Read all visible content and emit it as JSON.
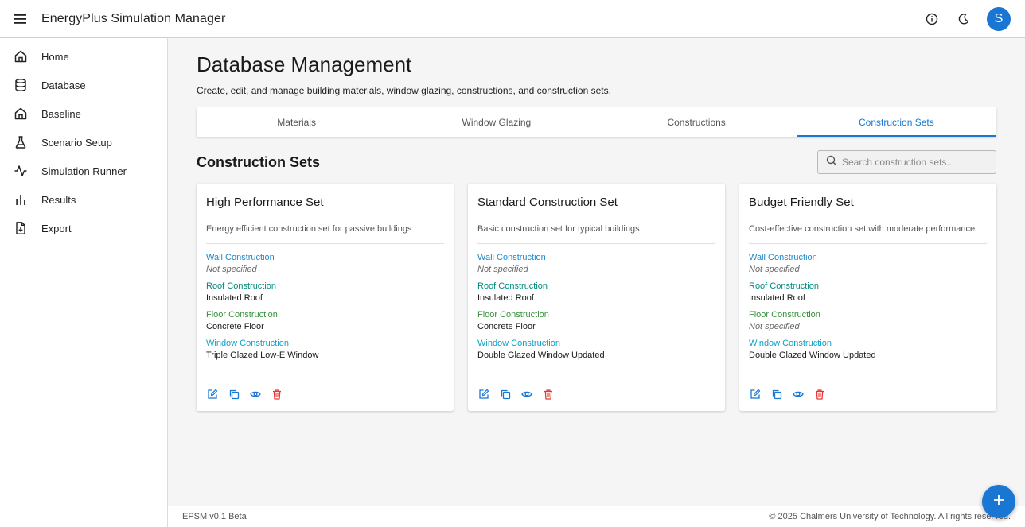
{
  "app": {
    "title": "EnergyPlus Simulation Manager",
    "avatar_initial": "S"
  },
  "sidebar": {
    "items": [
      {
        "label": "Home",
        "icon": "home-icon"
      },
      {
        "label": "Database",
        "icon": "database-icon"
      },
      {
        "label": "Baseline",
        "icon": "baseline-house-icon"
      },
      {
        "label": "Scenario Setup",
        "icon": "flask-icon"
      },
      {
        "label": "Simulation Runner",
        "icon": "activity-icon"
      },
      {
        "label": "Results",
        "icon": "bar-chart-icon"
      },
      {
        "label": "Export",
        "icon": "file-export-icon"
      }
    ]
  },
  "page": {
    "title": "Database Management",
    "subtitle": "Create, edit, and manage building materials, window glazing, constructions, and construction sets."
  },
  "tabs": [
    {
      "label": "Materials",
      "active": false
    },
    {
      "label": "Window Glazing",
      "active": false
    },
    {
      "label": "Constructions",
      "active": false
    },
    {
      "label": "Construction Sets",
      "active": true
    }
  ],
  "section": {
    "title": "Construction Sets",
    "search_placeholder": "Search construction sets...",
    "search_value": ""
  },
  "field_labels": {
    "wall": "Wall Construction",
    "roof": "Roof Construction",
    "floor": "Floor Construction",
    "window": "Window Construction"
  },
  "cards": [
    {
      "title": "High Performance Set",
      "description": "Energy efficient construction set for passive buildings",
      "wall": "Not specified",
      "roof": "Insulated Roof",
      "floor": "Concrete Floor",
      "window": "Triple Glazed Low-E Window"
    },
    {
      "title": "Standard Construction Set",
      "description": "Basic construction set for typical buildings",
      "wall": "Not specified",
      "roof": "Insulated Roof",
      "floor": "Concrete Floor",
      "window": "Double Glazed Window Updated"
    },
    {
      "title": "Budget Friendly Set",
      "description": "Cost-effective construction set with moderate performance",
      "wall": "Not specified",
      "roof": "Insulated Roof",
      "floor": "Not specified",
      "window": "Double Glazed Window Updated"
    }
  ],
  "footer": {
    "version": "EPSM v0.1 Beta",
    "copyright": "© 2025 Chalmers University of Technology. All rights reserved."
  },
  "colors": {
    "primary": "#1976d2",
    "delete": "#e53935",
    "wall_label": "#1e88c9",
    "roof_label": "#00897b",
    "floor_label": "#388e3c",
    "window_label": "#0ba3c7"
  }
}
